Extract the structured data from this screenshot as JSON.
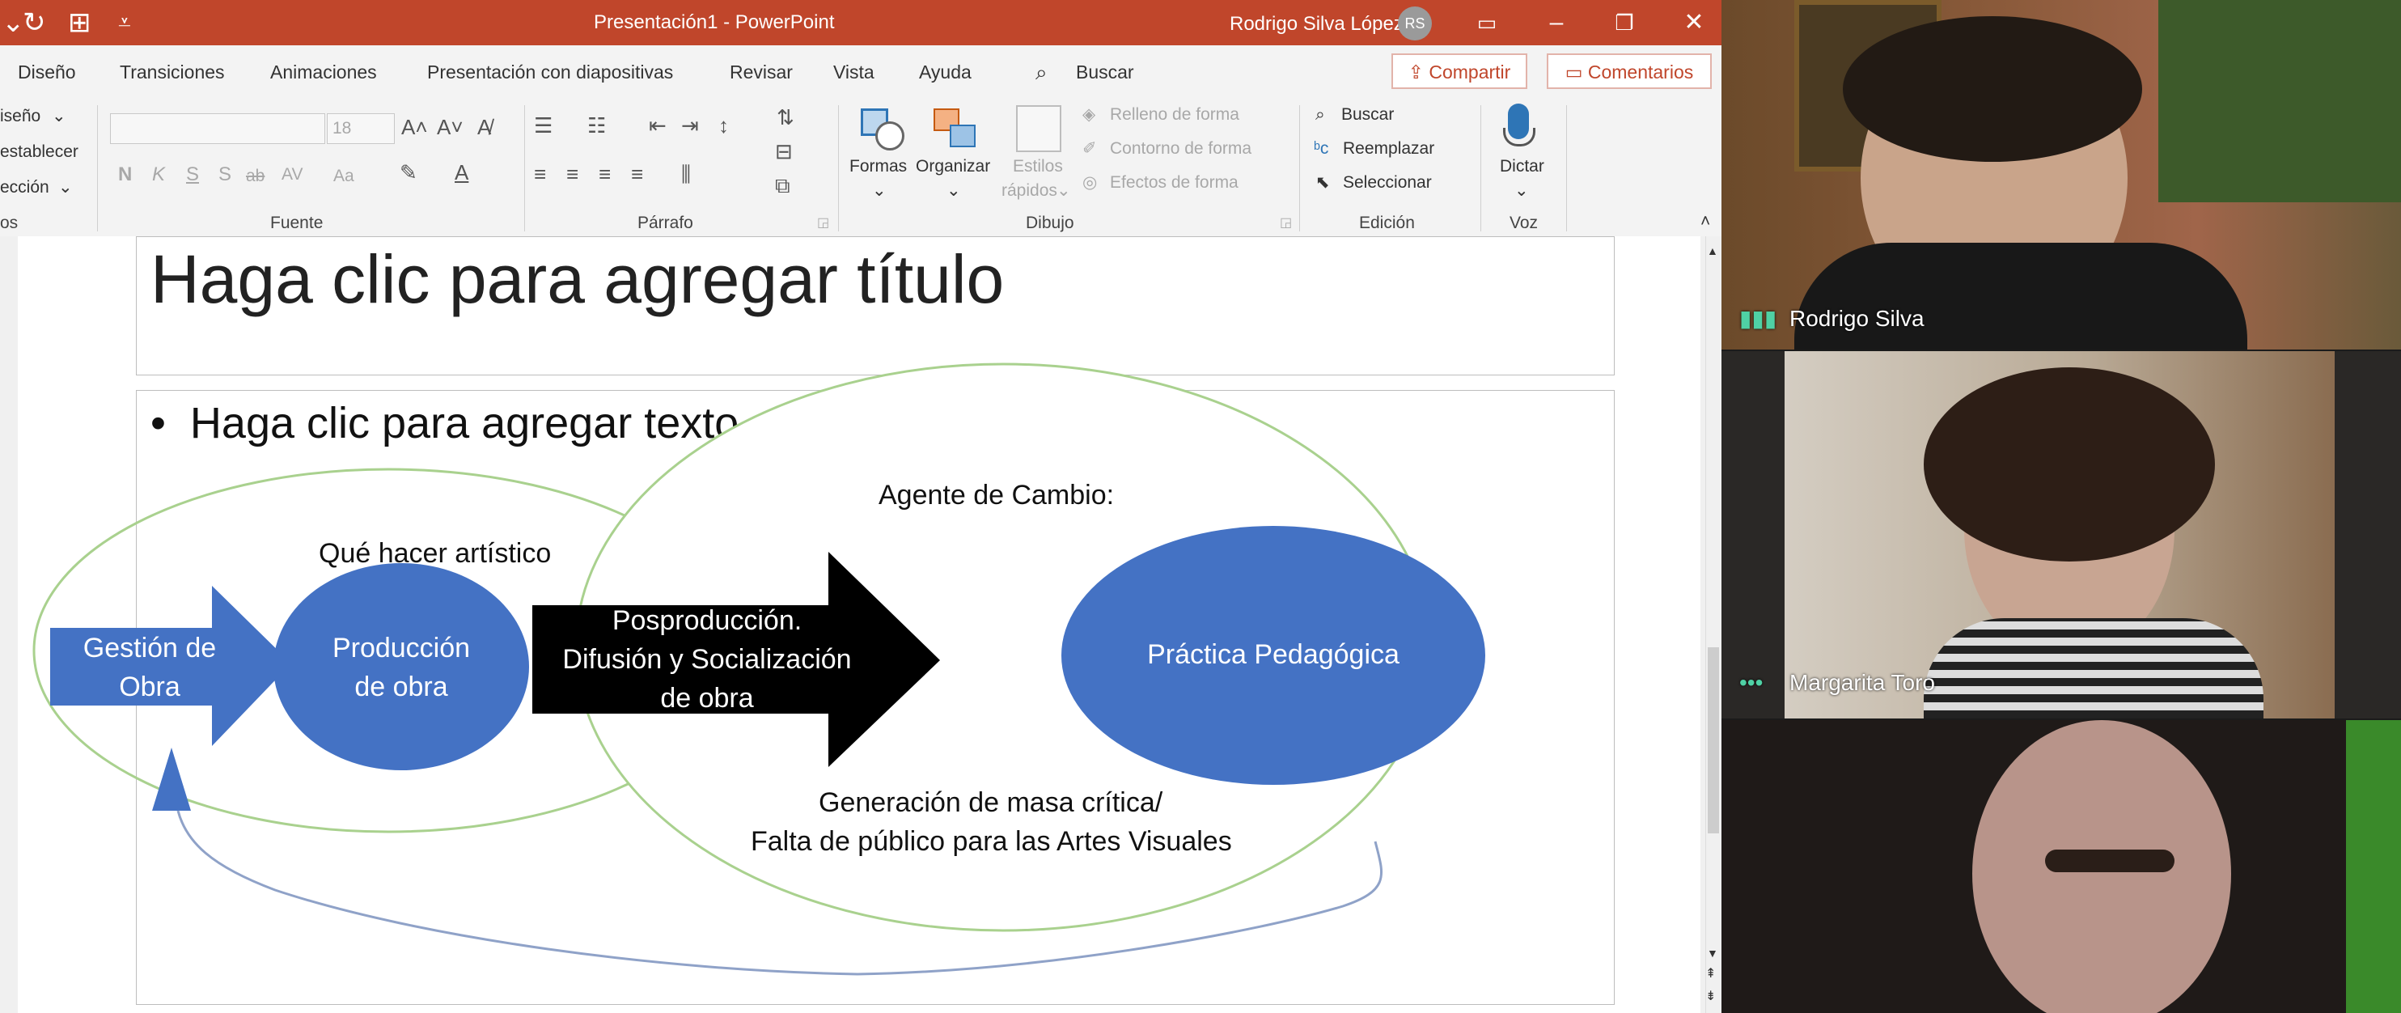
{
  "window": {
    "title": "Presentación1  -  PowerPoint",
    "user_name": "Rodrigo Silva López",
    "user_initials": "RS"
  },
  "ribbon": {
    "tabs": [
      "Diseño",
      "Transiciones",
      "Animaciones",
      "Presentación con diapositivas",
      "Revisar",
      "Vista",
      "Ayuda"
    ],
    "search_label": "Buscar",
    "share_label": "Compartir",
    "comments_label": "Comentarios",
    "slides_group": {
      "items": [
        "iseño",
        "establecer",
        "ección"
      ],
      "label": "os"
    },
    "font_group": {
      "label": "Fuente",
      "size": "18",
      "buttons": [
        "N",
        "K",
        "S",
        "S",
        "ab",
        "AV",
        "Aa"
      ]
    },
    "paragraph_group": {
      "label": "Párrafo"
    },
    "drawing_group": {
      "label": "Dibujo",
      "shapes": "Formas",
      "arrange": "Organizar",
      "quick_styles_1": "Estilos",
      "quick_styles_2": "rápidos",
      "fill": "Relleno de forma",
      "outline": "Contorno de forma",
      "effects": "Efectos de forma"
    },
    "editing_group": {
      "label": "Edición",
      "find": "Buscar",
      "replace": "Reemplazar",
      "select": "Seleccionar"
    },
    "voice_group": {
      "label": "Voz",
      "dictate": "Dictar"
    }
  },
  "slide": {
    "title_placeholder": "Haga clic para agregar título",
    "text_placeholder": "Haga clic para agregar texto",
    "diagram": {
      "agente": "Agente de Cambio:",
      "que_hacer": "Qué hacer artístico",
      "gestion_1": "Gestión de",
      "gestion_2": "Obra",
      "produccion_1": "Producción",
      "produccion_2": "de obra",
      "pospro_1": "Posproducción.",
      "pospro_2": "Difusión y Socialización",
      "pospro_3": "de obra",
      "practica": "Práctica Pedagógica",
      "generacion_1": "Generación de masa crítica/",
      "generacion_2": "Falta de público para las Artes Visuales"
    }
  },
  "participants": [
    {
      "name": "Rodrigo Silva"
    },
    {
      "name": "Margarita Toro"
    },
    {
      "name": ""
    }
  ],
  "colors": {
    "accent": "#c0462b",
    "diagram_blue": "#4472c4",
    "outline_green": "#a9d18e"
  }
}
